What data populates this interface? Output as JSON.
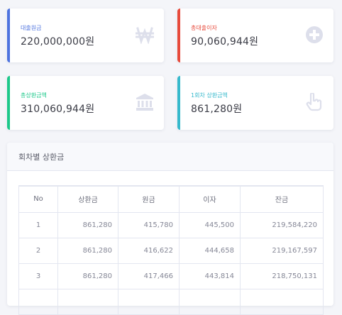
{
  "cards": {
    "loan": {
      "label": "대출원금",
      "value": "220,000,000원",
      "accent": "#4e73df",
      "icon": "won-icon"
    },
    "interest": {
      "label": "총대출이자",
      "value": "90,060,944원",
      "accent": "#e74a3b",
      "icon": "plus-circle-icon"
    },
    "total": {
      "label": "총상환금액",
      "value": "310,060,944원",
      "accent": "#1cc88a",
      "icon": "bank-icon"
    },
    "monthly": {
      "label": "1회차 상환금액",
      "value": "861,280원",
      "accent": "#36b9cc",
      "icon": "hand-pointer-icon"
    }
  },
  "schedule": {
    "title": "회차별 상환금",
    "columns": [
      "No",
      "상환금",
      "원금",
      "이자",
      "잔금"
    ],
    "rows": [
      [
        "1",
        "861,280",
        "415,780",
        "445,500",
        "219,584,220"
      ],
      [
        "2",
        "861,280",
        "416,622",
        "444,658",
        "219,167,597"
      ],
      [
        "3",
        "861,280",
        "417,466",
        "443,814",
        "218,750,131"
      ]
    ]
  }
}
